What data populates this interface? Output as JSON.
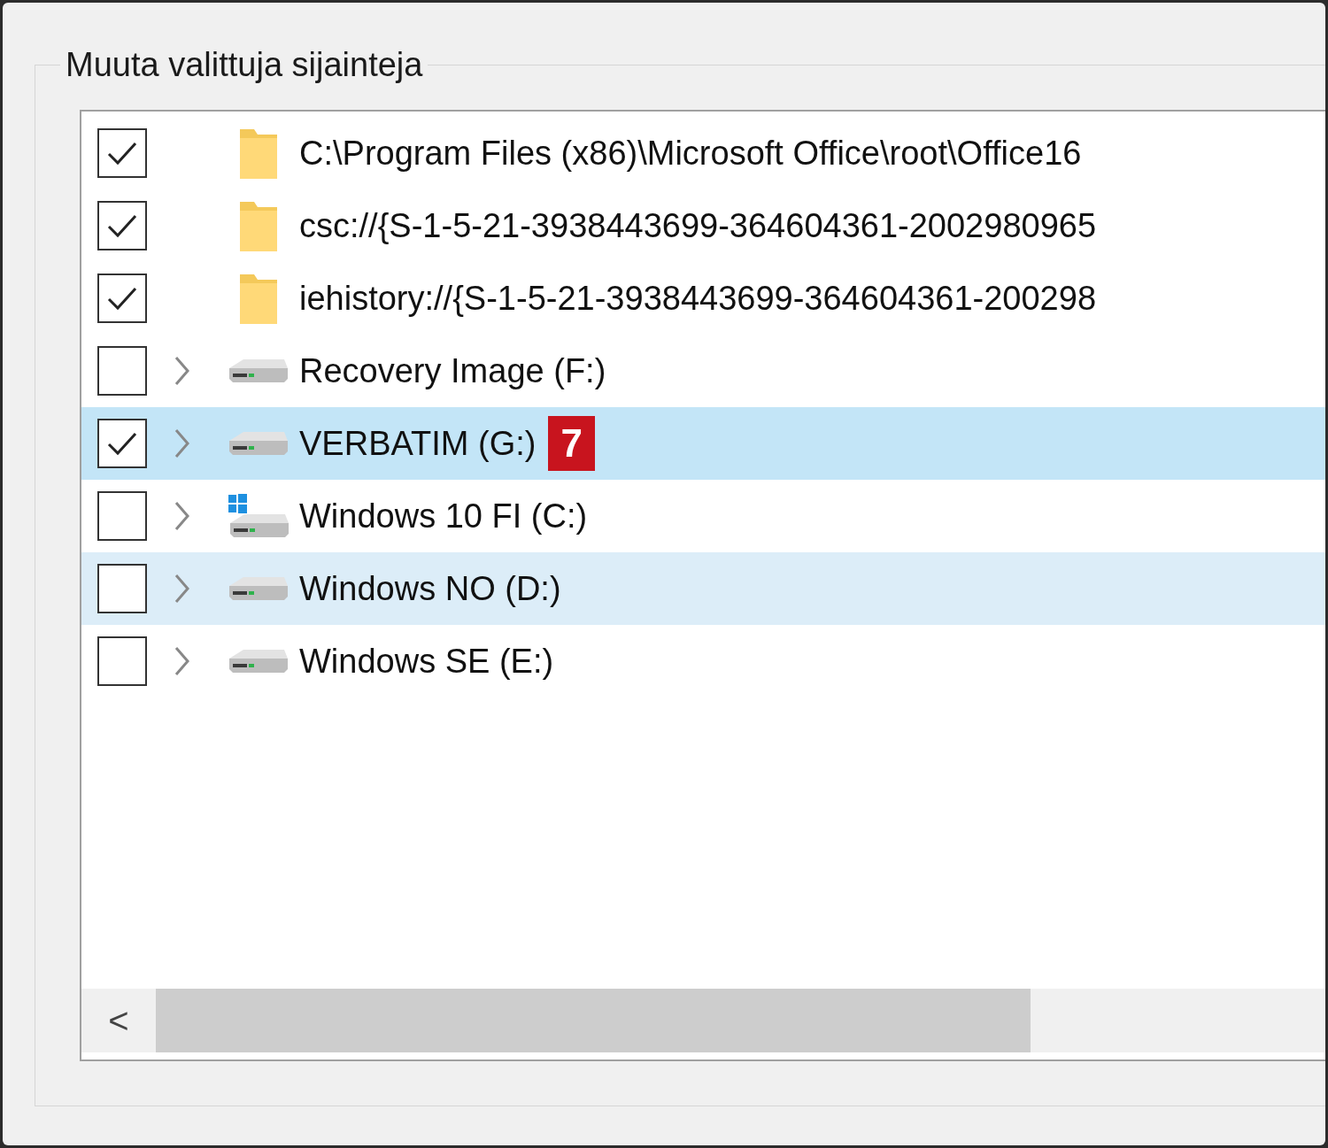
{
  "group": {
    "title": "Muuta valittuja sijainteja"
  },
  "items": [
    {
      "label": "C:\\Program Files (x86)\\Microsoft Office\\root\\Office16",
      "kind": "folder",
      "checked": true,
      "expandable": false,
      "selected": false,
      "hovered": false
    },
    {
      "label": "csc://{S-1-5-21-3938443699-364604361-2002980965",
      "kind": "folder",
      "checked": true,
      "expandable": false,
      "selected": false,
      "hovered": false
    },
    {
      "label": "iehistory://{S-1-5-21-3938443699-364604361-200298",
      "kind": "folder",
      "checked": true,
      "expandable": false,
      "selected": false,
      "hovered": false
    },
    {
      "label": "Recovery Image (F:)",
      "kind": "drive",
      "checked": false,
      "expandable": true,
      "selected": false,
      "hovered": false
    },
    {
      "label": "VERBATIM (G:)",
      "kind": "drive",
      "checked": true,
      "expandable": true,
      "selected": true,
      "hovered": false,
      "badge": "7"
    },
    {
      "label": "Windows 10 FI (C:)",
      "kind": "system-drive",
      "checked": false,
      "expandable": true,
      "selected": false,
      "hovered": false
    },
    {
      "label": "Windows NO (D:)",
      "kind": "drive",
      "checked": false,
      "expandable": true,
      "selected": false,
      "hovered": true
    },
    {
      "label": "Windows SE (E:)",
      "kind": "drive",
      "checked": false,
      "expandable": true,
      "selected": false,
      "hovered": false
    }
  ],
  "scrollbar": {
    "left_arrow": "<"
  }
}
